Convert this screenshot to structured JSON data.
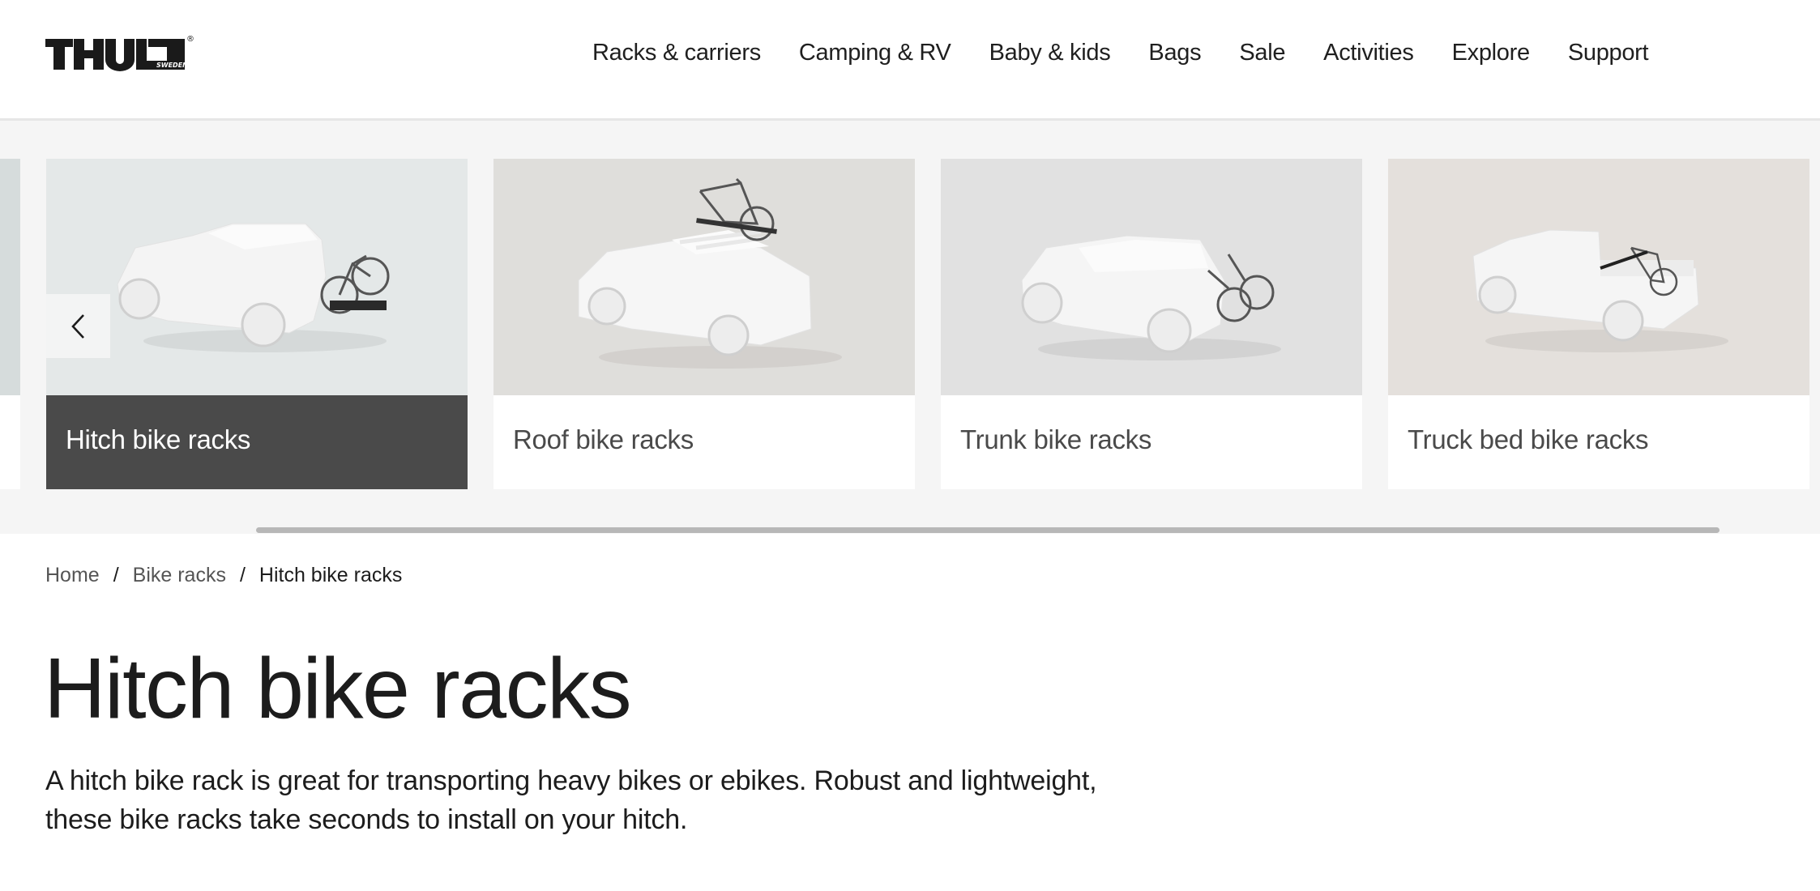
{
  "header": {
    "logo": {
      "text": "THULE",
      "subtext": "SWEDEN",
      "registered": "®"
    },
    "nav": [
      {
        "label": "Racks & carriers"
      },
      {
        "label": "Camping & RV"
      },
      {
        "label": "Baby & kids"
      },
      {
        "label": "Bags"
      },
      {
        "label": "Sale"
      },
      {
        "label": "Activities"
      },
      {
        "label": "Explore"
      },
      {
        "label": "Support"
      }
    ]
  },
  "carousel": {
    "prev_icon": "chevron-left-icon",
    "cards": [
      {
        "label": "Hitch bike racks",
        "active": true,
        "image_bg": "#e4e8e8",
        "image": "car-with-hitch-bike-rack"
      },
      {
        "label": "Roof bike racks",
        "active": false,
        "image_bg": "#dfdedb",
        "image": "car-with-roof-bike-rack"
      },
      {
        "label": "Trunk bike racks",
        "active": false,
        "image_bg": "#e1e1e1",
        "image": "car-with-trunk-bike-rack"
      },
      {
        "label": "Truck bed bike racks",
        "active": false,
        "image_bg": "#e4e0dc",
        "image": "pickup-with-truck-bed-bike-rack"
      }
    ],
    "scroll_position_fraction": 0.9
  },
  "breadcrumb": {
    "items": [
      {
        "label": "Home"
      },
      {
        "label": "Bike racks"
      },
      {
        "label": "Hitch bike racks"
      }
    ],
    "separator": "/"
  },
  "page": {
    "title": "Hitch bike racks",
    "description": "A hitch bike rack is great for transporting heavy bikes or ebikes. Robust and lightweight, these bike racks take seconds to install on your hitch."
  },
  "colors": {
    "active_card_bg": "#4a4a4a",
    "band_bg": "#f5f5f5",
    "text": "#1c1c1c"
  }
}
